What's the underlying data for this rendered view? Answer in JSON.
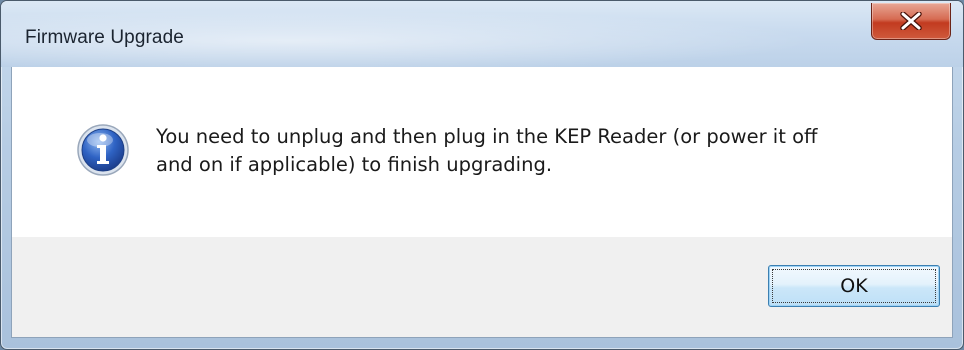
{
  "window": {
    "title": "Firmware Upgrade"
  },
  "dialog": {
    "message_line1": "You need to unplug and then plug in the KEP Reader (or power it off",
    "message_line2": "and on if applicable) to finish upgrading.",
    "icon": "info-icon"
  },
  "buttons": {
    "ok_label": "OK",
    "close_icon": "close-icon"
  },
  "colors": {
    "close_button": "#c94a2e",
    "info_icon": "#2c5fb8",
    "ok_border": "#3c7fb1",
    "footer_bg": "#f0f0f0"
  }
}
